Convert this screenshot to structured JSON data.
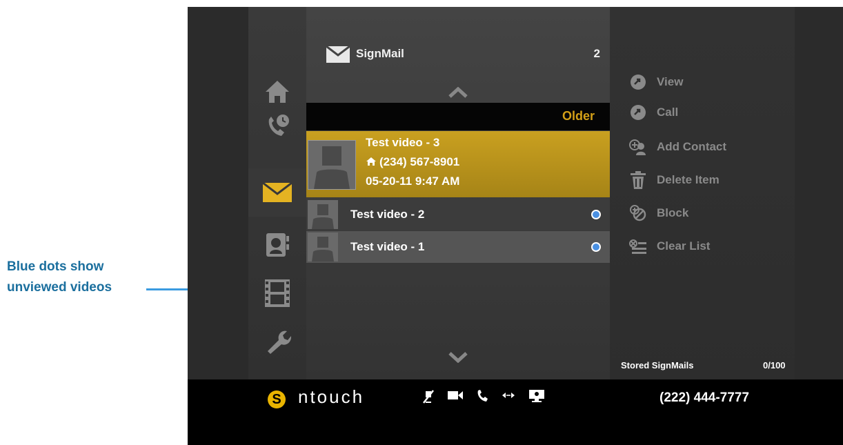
{
  "annotation": {
    "line1": "Blue dots show",
    "line2": "unviewed videos"
  },
  "list": {
    "title": "SignMail",
    "count": "2",
    "section_label": "Older",
    "selected": {
      "name": "Test video - 3",
      "phone": "(234) 567-8901",
      "datetime": "05-20-11  9:47 AM"
    },
    "items": [
      {
        "name": "Test video - 2"
      },
      {
        "name": "Test video - 1"
      }
    ]
  },
  "actions": {
    "items": [
      {
        "label": "View",
        "icon": "view-icon"
      },
      {
        "label": "Call",
        "icon": "call-icon"
      },
      {
        "label": "Add Contact",
        "icon": "add-contact-icon"
      },
      {
        "label": "Delete Item",
        "icon": "trash-icon"
      },
      {
        "label": "Block",
        "icon": "block-icon"
      },
      {
        "label": "Clear List",
        "icon": "clear-list-icon"
      }
    ],
    "stored_label": "Stored SignMails",
    "stored_count": "0/100"
  },
  "footer": {
    "brand": "ntouch",
    "phone": "(222) 444-7777"
  },
  "colors": {
    "accent": "#c9a020",
    "annotation": "#3a9be0",
    "unviewed_dot": "#4a90e2"
  }
}
